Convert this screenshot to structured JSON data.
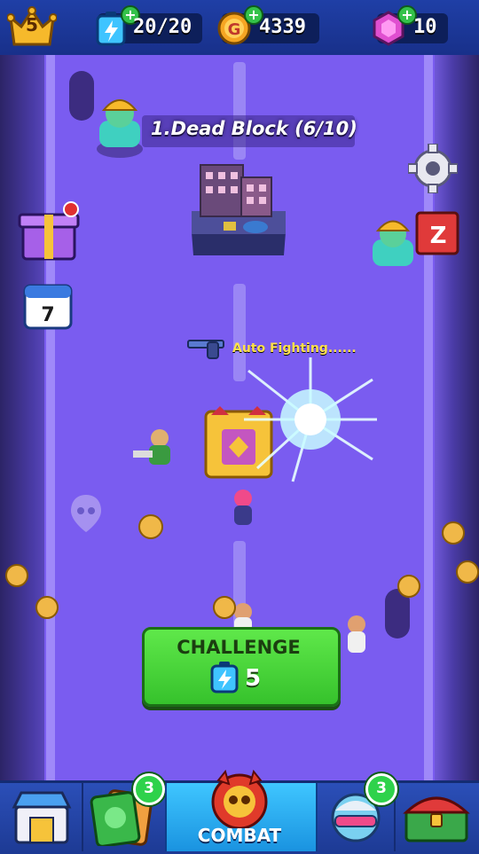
{
  "top_bar": {
    "level": "5",
    "energy": "20/20",
    "coins": "4339",
    "gems": "10"
  },
  "stage": {
    "title": "1.Dead Block (6/10)",
    "status": "Auto Fighting......"
  },
  "challenge": {
    "label": "CHALLENGE",
    "cost": "5"
  },
  "bottom_nav": {
    "card_badge": "3",
    "hero_badge": "3",
    "combat_label": "COMBAT"
  },
  "side_icons": {
    "calendar_day": "7",
    "notebook_letter": "Z"
  },
  "colors": {
    "road": "#7a5cf0",
    "accent_green": "#36c22c",
    "nav_blue": "#1d3a94"
  }
}
